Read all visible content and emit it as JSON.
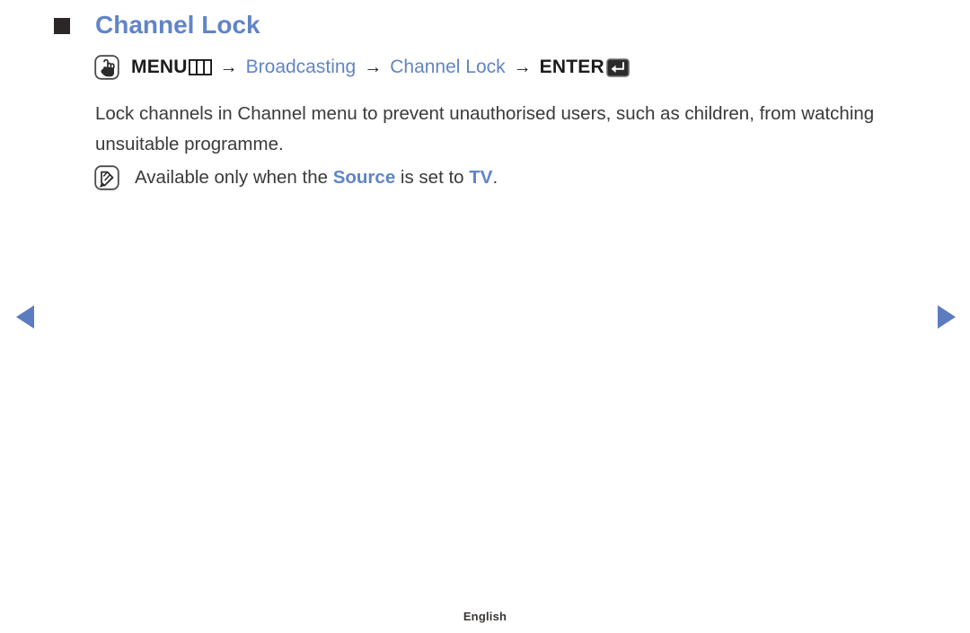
{
  "page": {
    "title": "Channel Lock",
    "bullet_icon": "filled-square-bullet",
    "accent_color": "#6184c8",
    "text_color": "#3a3a3a",
    "background_color": "#ffffff"
  },
  "menu_path": {
    "prefix_icon": "hand-press-button-icon",
    "menu_label": "MENU",
    "menu_icon": "menu-grid-icon",
    "separator": "→",
    "crumbs": [
      {
        "label": "Broadcasting",
        "style": "accent"
      },
      {
        "label": "Channel Lock",
        "style": "accent"
      }
    ],
    "enter_label": "ENTER",
    "enter_icon": "enter-return-arrow-icon"
  },
  "body": {
    "paragraph": "Lock channels in Channel menu to prevent unauthorised users, such as children, from watching unsuitable programme."
  },
  "note": {
    "icon": "note-pencil-icon",
    "text_before": "Available only when the ",
    "highlight_1": "Source",
    "text_middle": " is set to ",
    "highlight_2": "TV",
    "text_after": "."
  },
  "navigation": {
    "prev_icon": "triangle-left-icon",
    "next_icon": "triangle-right-icon",
    "arrow_color": "#5b7cc0"
  },
  "footer": {
    "language": "English"
  }
}
